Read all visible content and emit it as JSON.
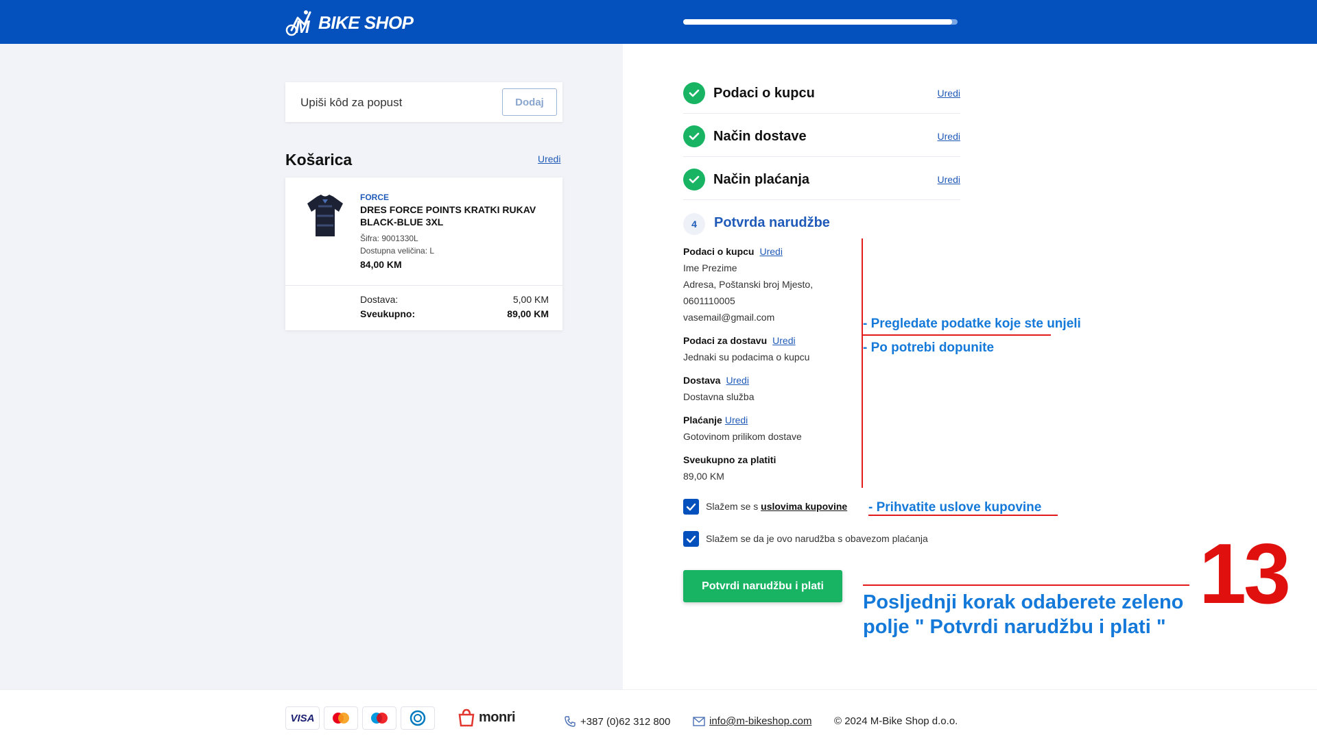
{
  "header": {
    "logo_text": "BIKE SHOP",
    "logo_letter": "M",
    "progress": 0.98
  },
  "discount": {
    "placeholder": "Upiši kôd za popust",
    "button": "Dodaj"
  },
  "cart": {
    "title": "Košarica",
    "edit": "Uredi",
    "product": {
      "brand": "FORCE",
      "name": "DRES FORCE POINTS KRATKI RUKAV BLACK-BLUE 3XL",
      "sku": "Šifra: 9001330L",
      "size": "Dostupna veličina: L",
      "price": "84,00 KM"
    },
    "shipping_label": "Dostava:",
    "shipping_value": "5,00 KM",
    "total_label": "Sveukupno:",
    "total_value": "89,00 KM"
  },
  "steps": [
    {
      "label": "Podaci o kupcu",
      "edit": "Uredi"
    },
    {
      "label": "Način dostave",
      "edit": "Uredi"
    },
    {
      "label": "Način plaćanja",
      "edit": "Uredi"
    }
  ],
  "step4": {
    "number": "4",
    "label": "Potvrda narudžbe"
  },
  "summary": {
    "buyer_title": "Podaci o kupcu",
    "buyer_edit": "Uredi",
    "buyer_name": "Ime Prezime",
    "buyer_address": "Adresa, Poštanski broj Mjesto,",
    "buyer_phone": "0601110005",
    "buyer_email": "vasemail@gmail.com",
    "delivery_data_title": "Podaci za dostavu",
    "delivery_data_edit": "Uredi",
    "delivery_data_value": "Jednaki su podacima o kupcu",
    "delivery_title": "Dostava",
    "delivery_edit": "Uredi",
    "delivery_value": "Dostavna služba",
    "payment_title": "Plaćanje",
    "payment_edit": "Uredi",
    "payment_value": "Gotovinom prilikom dostave",
    "total_title": "Sveukupno za platiti",
    "total_value": "89,00 KM"
  },
  "agreements": {
    "terms_prefix": "Slažem se s",
    "terms_link": "uslovima kupovine",
    "obligation": "Slažem se da je ovo narudžba s obavezom plaćanja"
  },
  "confirm_button": "Potvrdi narudžbu i plati",
  "annotations": {
    "review": "- Pregledate podatke koje ste unjeli",
    "complete": "- Po potrebi dopunite",
    "accept": "- Prihvatite uslove kupovine",
    "final": "Posljednji korak odaberete zeleno polje \" Potvrdi narudžbu i plati \"",
    "step_number": "13"
  },
  "footer": {
    "cards": [
      "VISA"
    ],
    "brand": "monri",
    "phone": "+387 (0)62 312 800",
    "email": "info@m-bikeshop.com",
    "copyright": "© 2024 M-Bike Shop d.o.o."
  },
  "colors": {
    "brand_blue": "#0450bd",
    "success_green": "#18b464",
    "annotation_red": "#e21a1a",
    "annotation_blue": "#1479d9"
  }
}
